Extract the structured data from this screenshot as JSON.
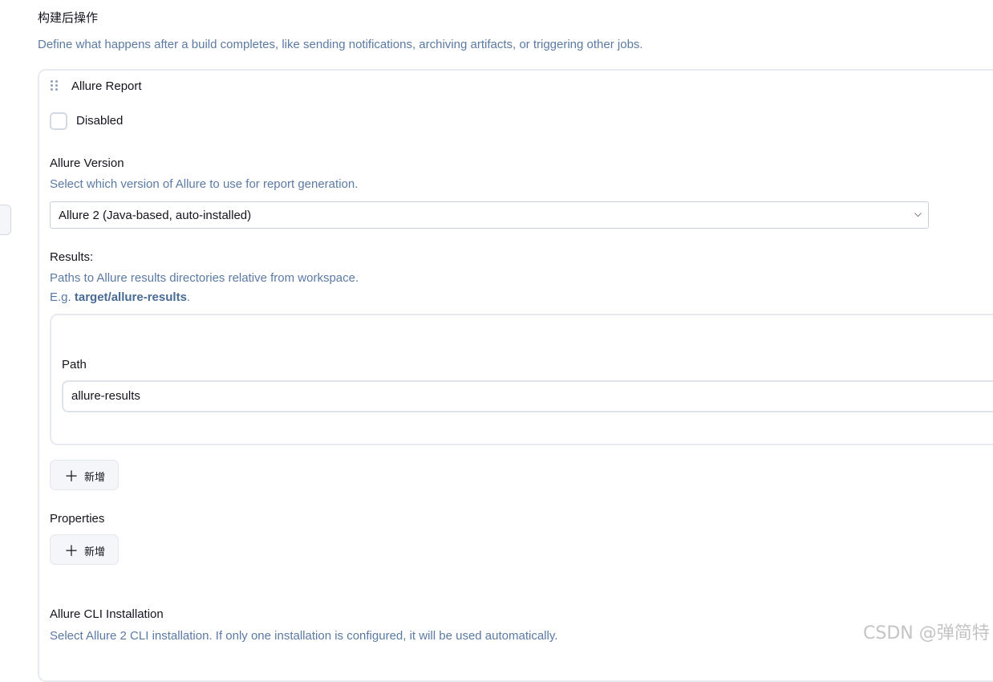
{
  "section": {
    "title": "构建后操作",
    "description": "Define what happens after a build completes, like sending notifications, archiving artifacts, or triggering other jobs."
  },
  "step": {
    "title": "Allure Report",
    "disabled_label": "Disabled",
    "disabled_checked": false
  },
  "allure_version": {
    "label": "Allure Version",
    "help": "Select which version of Allure to use for report generation.",
    "selected": "Allure 2 (Java-based, auto-installed)"
  },
  "results": {
    "label": "Results:",
    "help_line1": "Paths to Allure results directories relative from workspace.",
    "help_eg_prefix": "E.g. ",
    "help_eg_value": "target/allure-results",
    "help_eg_suffix": ".",
    "path_label": "Path",
    "path_value": "allure-results",
    "add_label": "新增"
  },
  "properties": {
    "label": "Properties",
    "add_label": "新增"
  },
  "cli_installation": {
    "label": "Allure CLI Installation",
    "help": "Select Allure 2 CLI installation. If only one installation is configured, it will be used automatically."
  },
  "watermark": "CSDN @弹简特"
}
